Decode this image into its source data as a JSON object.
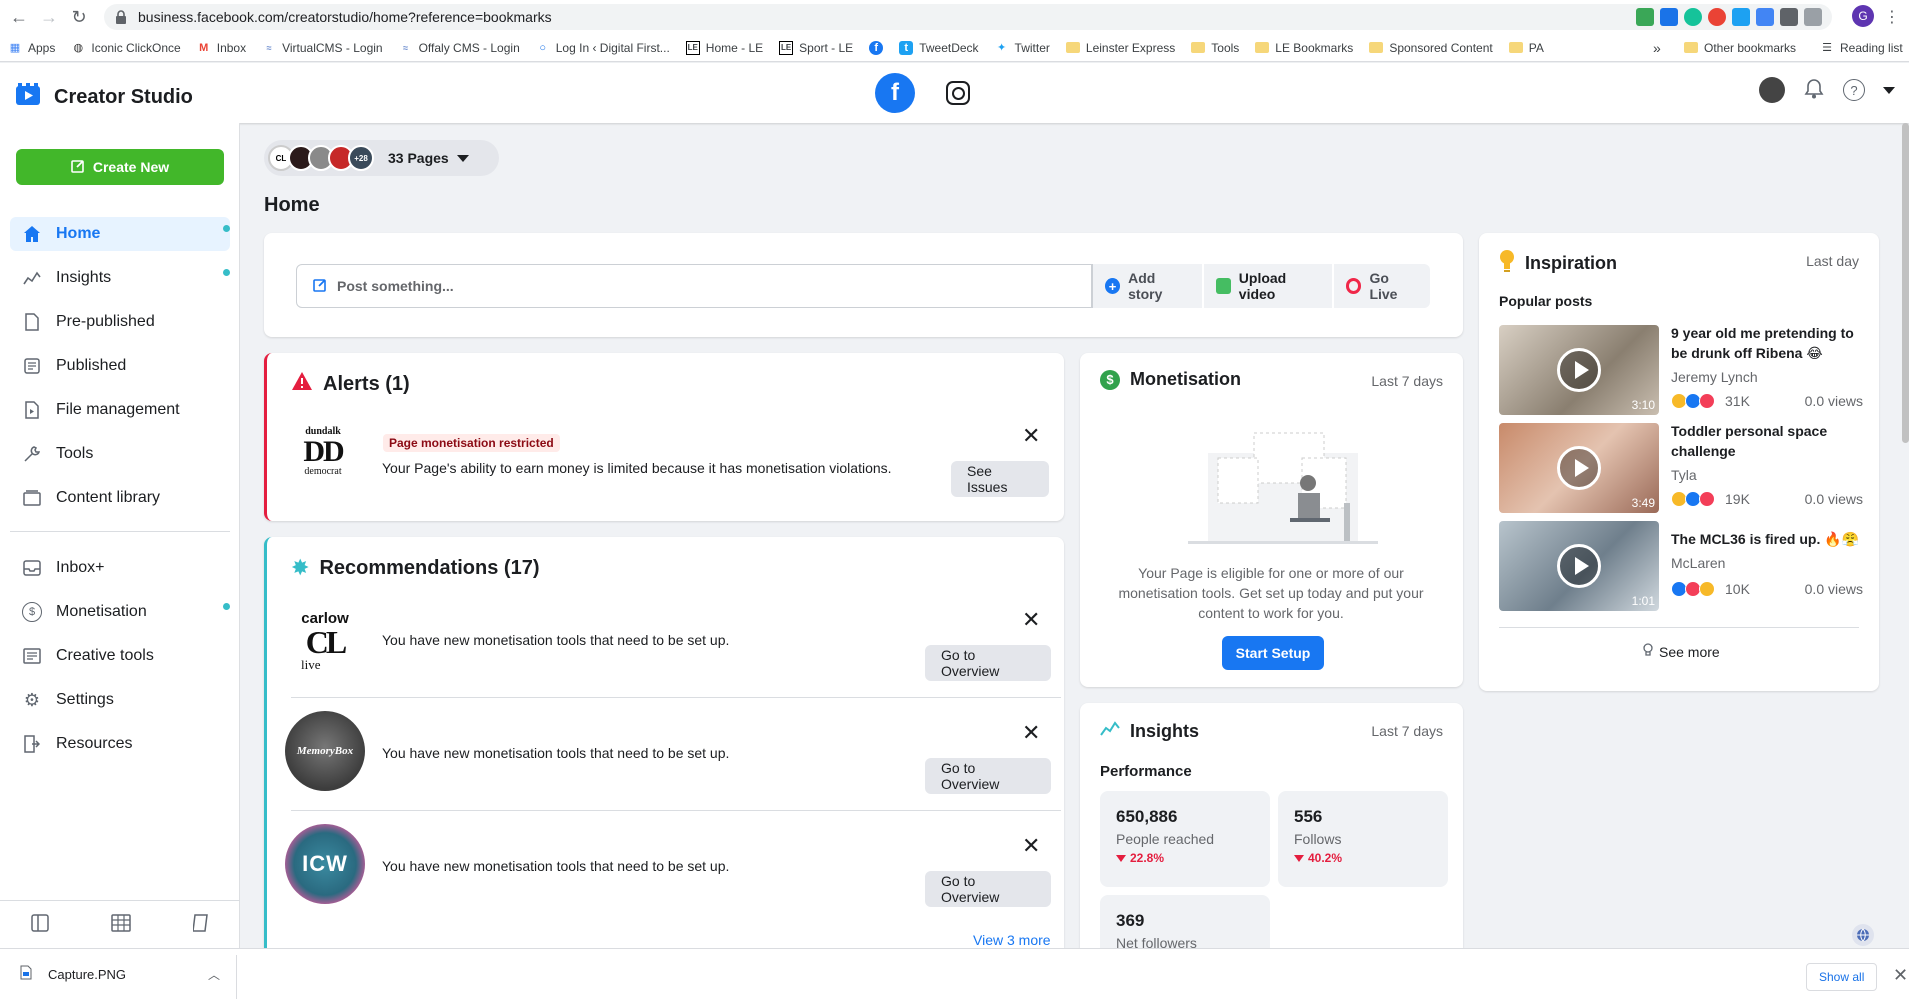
{
  "browser": {
    "url": "business.facebook.com/creatorstudio/home?reference=bookmarks",
    "bookmarks": [
      "Apps",
      "Iconic ClickOnce",
      "Inbox",
      "VirtualCMS - Login",
      "Offaly CMS - Login",
      "Log In ‹ Digital First...",
      "Home - LE",
      "Sport - LE",
      "TweetDeck",
      "Twitter",
      "Leinster Express",
      "Tools",
      "LE Bookmarks",
      "Sponsored Content",
      "PA"
    ],
    "overflow": "»",
    "other_bookmarks": "Other bookmarks",
    "reading_list": "Reading list",
    "profile_initial": "G"
  },
  "header": {
    "brand": "Creator Studio"
  },
  "sidebar": {
    "create_label": "Create New",
    "items": [
      {
        "label": "Home"
      },
      {
        "label": "Insights"
      },
      {
        "label": "Pre-published"
      },
      {
        "label": "Published"
      },
      {
        "label": "File management"
      },
      {
        "label": "Tools"
      },
      {
        "label": "Content library"
      },
      {
        "label": "Inbox+"
      },
      {
        "label": "Monetisation"
      },
      {
        "label": "Creative tools"
      },
      {
        "label": "Settings"
      },
      {
        "label": "Resources"
      }
    ]
  },
  "pages": {
    "label": "33 Pages",
    "extra_count": "+28"
  },
  "home": {
    "title": "Home",
    "composer": {
      "placeholder": "Post something...",
      "add_story": "Add story",
      "upload_video": "Upload video",
      "go_live": "Go Live"
    }
  },
  "alerts": {
    "title": "Alerts (1)",
    "badge": "Page monetisation restricted",
    "message": "Your Page's ability to earn money is limited because it has monetisation violations.",
    "button": "See Issues",
    "logo_text": "dundalk DD democrat"
  },
  "recommendations": {
    "title": "Recommendations (17)",
    "items": [
      {
        "text": "You have new monetisation tools that need to be set up.",
        "button": "Go to Overview"
      },
      {
        "text": "You have new monetisation tools that need to be set up.",
        "button": "Go to Overview"
      },
      {
        "text": "You have new monetisation tools that need to be set up.",
        "button": "Go to Overview"
      }
    ],
    "view_more": "View 3 more",
    "logo_carlow": "carlow CL live",
    "logo_icw": "ICW"
  },
  "monetisation": {
    "title": "Monetisation",
    "period": "Last 7 days",
    "text": "Your Page is eligible for one or more of our monetisation tools. Get set up today and put your content to work for you.",
    "button": "Start Setup"
  },
  "insights": {
    "title": "Insights",
    "period": "Last 7 days",
    "performance": "Performance",
    "stats": [
      {
        "value": "650,886",
        "label": "People reached",
        "change": "22.8%"
      },
      {
        "value": "556",
        "label": "Follows",
        "change": "40.2%"
      },
      {
        "value": "369",
        "label": "Net followers"
      }
    ]
  },
  "inspiration": {
    "title": "Inspiration",
    "period": "Last day",
    "popular": "Popular posts",
    "videos": [
      {
        "title": "9 year old me pretending to be drunk off Ribena 😂",
        "author": "Jeremy Lynch",
        "reactions": "31K",
        "views": "0.0 views",
        "duration": "3:10"
      },
      {
        "title": "Toddler personal space challenge",
        "author": "Tyla",
        "reactions": "19K",
        "views": "0.0 views",
        "duration": "3:49"
      },
      {
        "title": "The MCL36 is fired up. 🔥😤",
        "author": "McLaren",
        "reactions": "10K",
        "views": "0.0 views",
        "duration": "1:01"
      }
    ],
    "see_more": "See more"
  },
  "downloads": {
    "file": "Capture.PNG",
    "show_all": "Show all"
  },
  "colors": {
    "accent": "#1877f2",
    "green": "#42b72a",
    "alert_red": "#e41e3f",
    "teal": "#36bdc8"
  }
}
